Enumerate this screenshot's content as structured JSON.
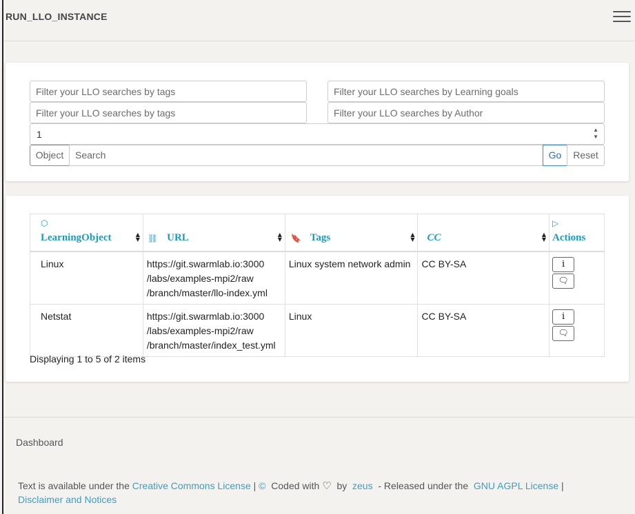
{
  "app": {
    "title": "RUN_LLO_INSTANCE"
  },
  "filters": {
    "tags1_placeholder": "Filter your LLO searches by tags",
    "goals_placeholder": "Filter your LLO searches by Learning goals",
    "tags2_placeholder": "Filter your LLO searches by tags",
    "author_placeholder": "Filter your LLO searches by Author",
    "number_value": "1",
    "object_label": "Object",
    "search_placeholder": "Search",
    "go_label": "Go",
    "reset_label": "Reset"
  },
  "table": {
    "headers": {
      "learning_object": "LearningObject",
      "url": "URL",
      "tags": "Tags",
      "cc": "CC",
      "actions": "Actions"
    },
    "rows": [
      {
        "learning_object": "Linux",
        "url_1": "https://git.swarmlab.io:3000",
        "url_2": "/labs/examples-mpi2/raw",
        "url_3": "/branch/master/llo-index.yml",
        "tags": "Linux system network admin",
        "cc": "CC BY-SA"
      },
      {
        "learning_object": "Netstat",
        "url_1": "https://git.swarmlab.io:3000",
        "url_2": "/labs/examples-mpi2/raw",
        "url_3": "/branch/master/index_test.yml",
        "tags": "Linux",
        "cc": "CC BY-SA"
      }
    ],
    "pagination_text": "Displaying 1 to 5 of 2 items"
  },
  "footer": {
    "dashboard": "Dashboard",
    "text_available": "Text is available under the",
    "cc_license_link": "Creative Commons License",
    "separator": "|",
    "copyright_symbol": "©",
    "coded_with": "Coded with",
    "by": "by",
    "author_link": "zeus",
    "released_under": "- Released under the",
    "agpl_link": "GNU AGPL License",
    "disclaimer_link": "Disclaimer and Notices"
  },
  "colors": {
    "accent": "#1d9bbd",
    "link": "#3a9fc4",
    "go_button": "#1a73c9"
  }
}
